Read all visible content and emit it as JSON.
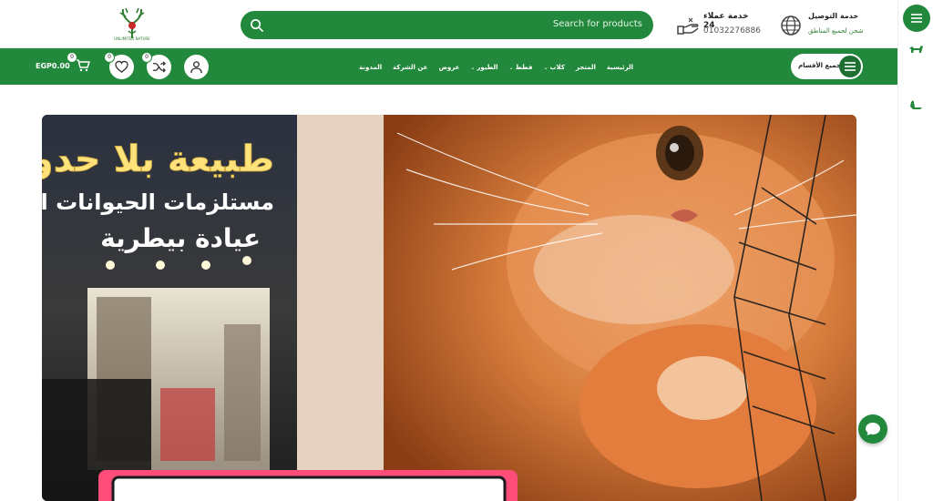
{
  "header": {
    "logo_alt": "Unlimited Nature",
    "logo_caption": "UNLIMITED NATURE",
    "search_placeholder": "Search for products",
    "support": {
      "title": "خدمة عملاء 24",
      "phone": "01032276886"
    },
    "delivery": {
      "title": "خدمة التوصيل",
      "subtitle": "شحن لجميع المناطق"
    }
  },
  "nav": {
    "cart_total": "EGP0.00",
    "cart_count": "0",
    "wishlist_count": "0",
    "compare_count": "0",
    "menu": [
      {
        "label": "الرئيسية",
        "has_dropdown": false
      },
      {
        "label": "المتجر",
        "has_dropdown": false
      },
      {
        "label": "كلاب",
        "has_dropdown": true
      },
      {
        "label": "قطط",
        "has_dropdown": true
      },
      {
        "label": "الطيور",
        "has_dropdown": true
      },
      {
        "label": "عروض",
        "has_dropdown": false
      },
      {
        "label": "عن الشركة",
        "has_dropdown": false
      },
      {
        "label": "المدونة",
        "has_dropdown": false
      }
    ],
    "all_categories": "جميع الأقسام"
  },
  "hero": {
    "sign_line1": "طبيعة بلا حدود",
    "sign_line2": "مستلزمات الحيوانات الأليفة",
    "sign_line3": "عيادة بيطرية"
  },
  "colors": {
    "brand_green": "#22893c",
    "dark_green": "#1f6f33"
  },
  "icons": [
    "search-icon",
    "support-hand-icon",
    "globe-icon",
    "user-icon",
    "shuffle-icon",
    "heart-icon",
    "cart-icon",
    "menu-icon",
    "dog-icon",
    "bird-icon",
    "chat-icon"
  ]
}
